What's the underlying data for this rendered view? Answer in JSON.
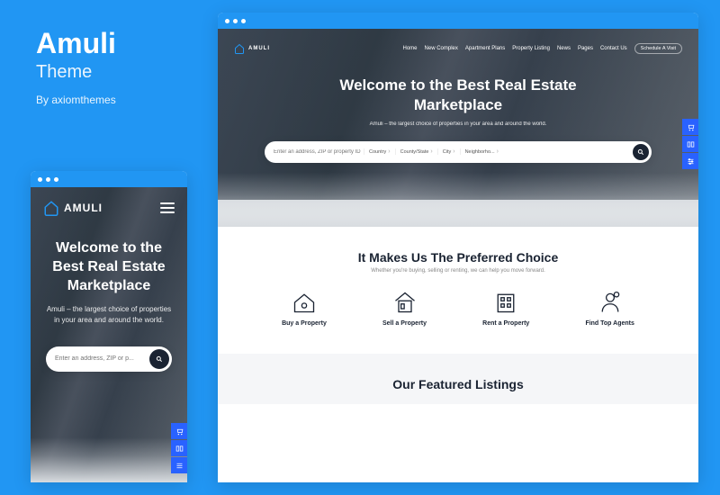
{
  "promo": {
    "title": "Amuli",
    "subtitle": "Theme",
    "author": "By axiomthemes"
  },
  "brand": "AMULI",
  "nav": {
    "items": [
      "Home",
      "New Complex",
      "Apartment Plans",
      "Property Listing",
      "News",
      "Pages",
      "Contact Us"
    ],
    "cta": "Schedule A Visit"
  },
  "hero": {
    "title_desktop": "Welcome to the Best Real Estate Marketplace",
    "title_mobile": "Welcome to the Best Real Estate Marketplace",
    "sub_desktop": "Amuli – the largest choice of properties in your area and around the world.",
    "sub_mobile": "Amuli – the largest choice of properties in your area and around the world."
  },
  "search": {
    "placeholder_desktop": "Enter an address, ZIP or property ID",
    "placeholder_mobile": "Enter an address, ZIP or p...",
    "selects": [
      "Country",
      "County/State",
      "City",
      "Neighborho..."
    ]
  },
  "section_preferred": {
    "title": "It Makes Us The Preferred Choice",
    "lead": "Whether you're buying, selling or renting, we can help you move forward.",
    "features": [
      {
        "label": "Buy a Property"
      },
      {
        "label": "Sell a Property"
      },
      {
        "label": "Rent a Property"
      },
      {
        "label": "Find Top Agents"
      }
    ]
  },
  "section_featured": {
    "title": "Our Featured Listings"
  }
}
